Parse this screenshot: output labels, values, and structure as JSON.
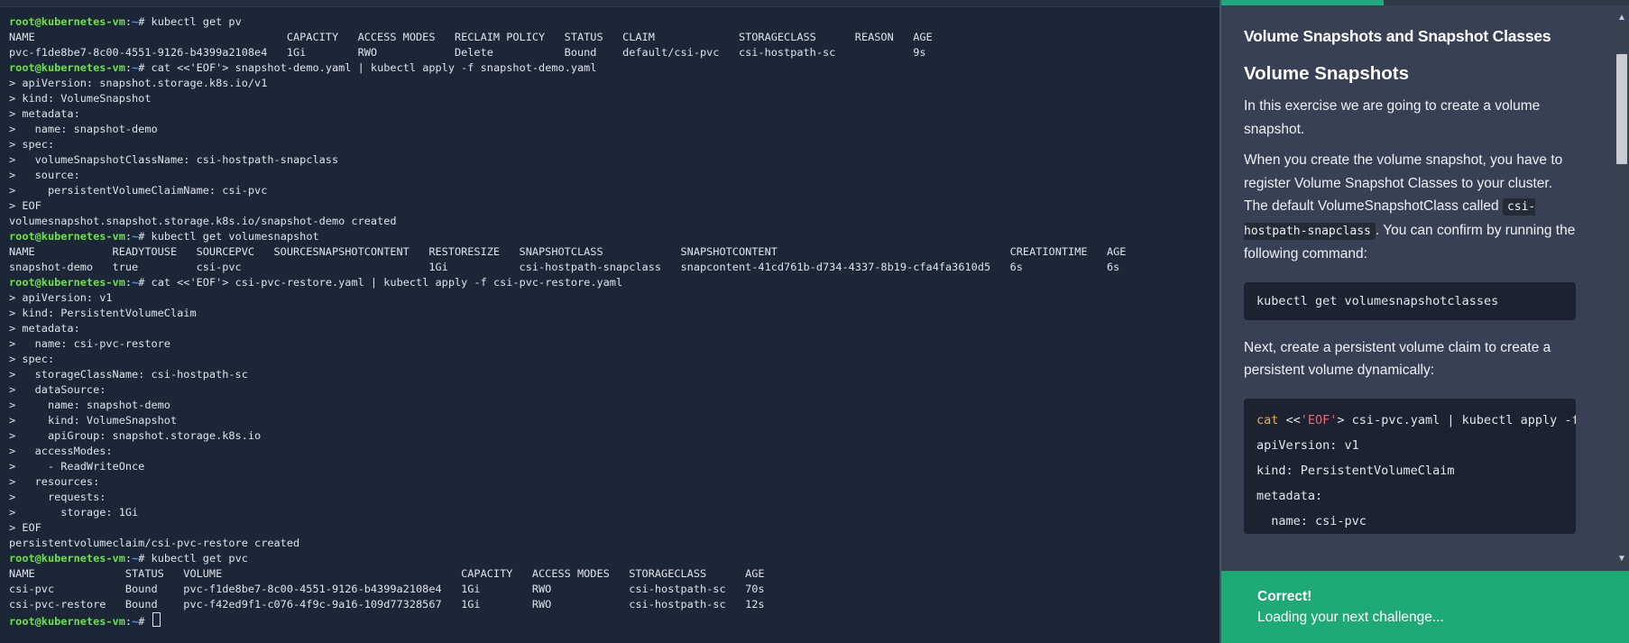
{
  "terminal": {
    "prompt": {
      "user": "root@kubernetes-vm",
      "sep": ":",
      "path": "~",
      "symbol": "# "
    },
    "lines": [
      {
        "type": "prompt",
        "cmd": "kubectl get pv"
      },
      {
        "type": "out",
        "text": "NAME                                       CAPACITY   ACCESS MODES   RECLAIM POLICY   STATUS   CLAIM             STORAGECLASS      REASON   AGE"
      },
      {
        "type": "out",
        "text": "pvc-f1de8be7-8c00-4551-9126-b4399a2108e4   1Gi        RWO            Delete           Bound    default/csi-pvc   csi-hostpath-sc            9s"
      },
      {
        "type": "prompt",
        "cmd": "cat <<'EOF'> snapshot-demo.yaml | kubectl apply -f snapshot-demo.yaml"
      },
      {
        "type": "out",
        "text": "> apiVersion: snapshot.storage.k8s.io/v1"
      },
      {
        "type": "out",
        "text": "> kind: VolumeSnapshot"
      },
      {
        "type": "out",
        "text": "> metadata:"
      },
      {
        "type": "out",
        "text": ">   name: snapshot-demo"
      },
      {
        "type": "out",
        "text": "> spec:"
      },
      {
        "type": "out",
        "text": ">   volumeSnapshotClassName: csi-hostpath-snapclass"
      },
      {
        "type": "out",
        "text": ">   source:"
      },
      {
        "type": "out",
        "text": ">     persistentVolumeClaimName: csi-pvc"
      },
      {
        "type": "out",
        "text": "> EOF"
      },
      {
        "type": "out",
        "text": "volumesnapshot.snapshot.storage.k8s.io/snapshot-demo created"
      },
      {
        "type": "prompt",
        "cmd": "kubectl get volumesnapshot"
      },
      {
        "type": "out",
        "text": "NAME            READYTOUSE   SOURCEPVC   SOURCESNAPSHOTCONTENT   RESTORESIZE   SNAPSHOTCLASS            SNAPSHOTCONTENT                                    CREATIONTIME   AGE"
      },
      {
        "type": "out",
        "text": "snapshot-demo   true         csi-pvc                             1Gi           csi-hostpath-snapclass   snapcontent-41cd761b-d734-4337-8b19-cfa4fa3610d5   6s             6s"
      },
      {
        "type": "prompt",
        "cmd": "cat <<'EOF'> csi-pvc-restore.yaml | kubectl apply -f csi-pvc-restore.yaml"
      },
      {
        "type": "out",
        "text": "> apiVersion: v1"
      },
      {
        "type": "out",
        "text": "> kind: PersistentVolumeClaim"
      },
      {
        "type": "out",
        "text": "> metadata:"
      },
      {
        "type": "out",
        "text": ">   name: csi-pvc-restore"
      },
      {
        "type": "out",
        "text": "> spec:"
      },
      {
        "type": "out",
        "text": ">   storageClassName: csi-hostpath-sc"
      },
      {
        "type": "out",
        "text": ">   dataSource:"
      },
      {
        "type": "out",
        "text": ">     name: snapshot-demo"
      },
      {
        "type": "out",
        "text": ">     kind: VolumeSnapshot"
      },
      {
        "type": "out",
        "text": ">     apiGroup: snapshot.storage.k8s.io"
      },
      {
        "type": "out",
        "text": ">   accessModes:"
      },
      {
        "type": "out",
        "text": ">     - ReadWriteOnce"
      },
      {
        "type": "out",
        "text": ">   resources:"
      },
      {
        "type": "out",
        "text": ">     requests:"
      },
      {
        "type": "out",
        "text": ">       storage: 1Gi"
      },
      {
        "type": "out",
        "text": "> EOF"
      },
      {
        "type": "out",
        "text": "persistentvolumeclaim/csi-pvc-restore created"
      },
      {
        "type": "prompt",
        "cmd": "kubectl get pvc"
      },
      {
        "type": "out",
        "text": "NAME              STATUS   VOLUME                                     CAPACITY   ACCESS MODES   STORAGECLASS      AGE"
      },
      {
        "type": "out",
        "text": "csi-pvc           Bound    pvc-f1de8be7-8c00-4551-9126-b4399a2108e4   1Gi        RWO            csi-hostpath-sc   70s"
      },
      {
        "type": "out",
        "text": "csi-pvc-restore   Bound    pvc-f42ed9f1-c076-4f9c-9a16-109d77328567   1Gi        RWO            csi-hostpath-sc   12s"
      },
      {
        "type": "prompt",
        "cmd": "",
        "cursor": true
      }
    ]
  },
  "panel": {
    "title": "Volume Snapshots and Snapshot Classes",
    "heading": "Volume Snapshots",
    "para1": "In this exercise we are going to create a volume snapshot.",
    "para2_a": "When you create the volume snapshot, you have to register Volume Snapshot Classes to your cluster. The default VolumeSnapshotClass called ",
    "para2_code": "csi-hostpath-snapclass",
    "para2_b": ". You can confirm by running the following command:",
    "code1": "kubectl get volumesnapshotclasses",
    "para3": "Next, create a persistent volume claim to create a persistent volume dynamically:",
    "code2": {
      "line1_cat": "cat",
      "line1_op": " <<",
      "line1_str": "'EOF'",
      "line1_rest": "> csi-pvc.yaml | kubectl apply -f csi-pvc.yaml",
      "line2": "apiVersion: v1",
      "line3": "kind: PersistentVolumeClaim",
      "line4": "metadata:",
      "line5": "  name: csi-pvc"
    }
  },
  "banner": {
    "title": "Correct!",
    "subtitle": "Loading your next challenge..."
  }
}
